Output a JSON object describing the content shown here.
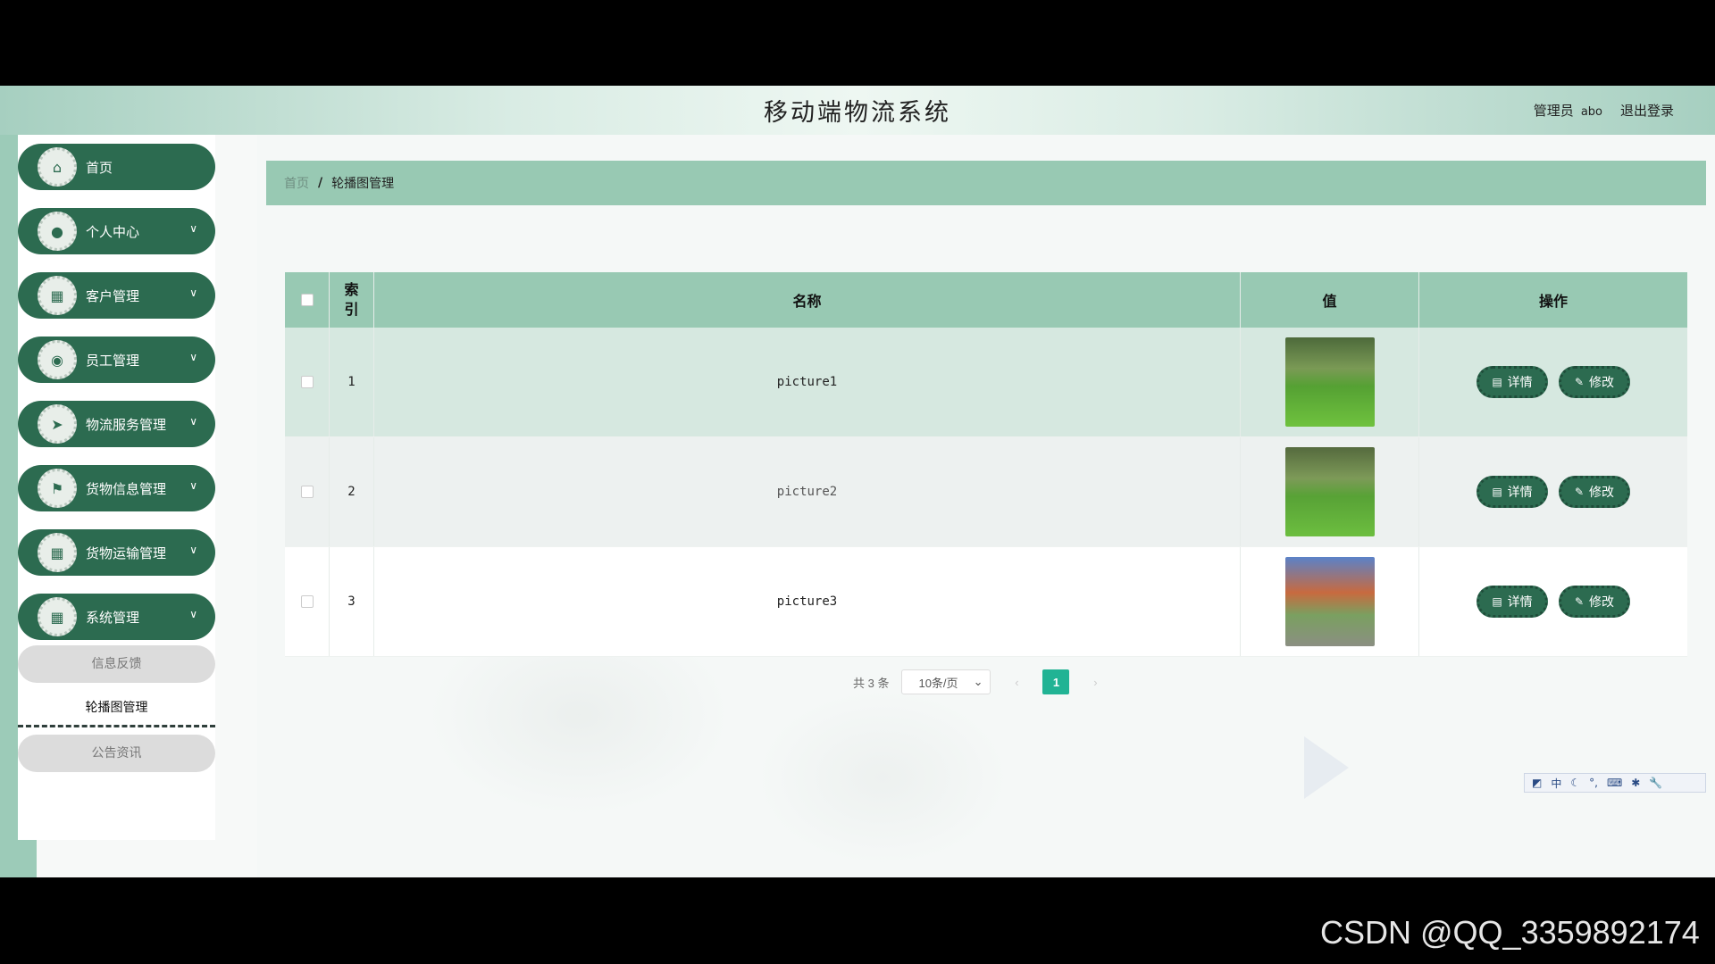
{
  "header": {
    "app_title": "移动端物流系统",
    "user_role": "管理员",
    "user_name": "abo",
    "logout_label": "退出登录"
  },
  "sidebar": {
    "items": [
      {
        "label": "首页",
        "icon": "home-icon",
        "has_arrow": false
      },
      {
        "label": "个人中心",
        "icon": "user-icon",
        "has_arrow": true
      },
      {
        "label": "客户管理",
        "icon": "grid-icon",
        "has_arrow": true
      },
      {
        "label": "员工管理",
        "icon": "location-icon",
        "has_arrow": true
      },
      {
        "label": "物流服务管理",
        "icon": "send-icon",
        "has_arrow": true
      },
      {
        "label": "货物信息管理",
        "icon": "flag-icon",
        "has_arrow": true
      },
      {
        "label": "货物运输管理",
        "icon": "grid-icon",
        "has_arrow": true
      },
      {
        "label": "系统管理",
        "icon": "grid-icon",
        "has_arrow": true
      }
    ],
    "sub_items": [
      {
        "label": "信息反馈"
      },
      {
        "label": "轮播图管理"
      },
      {
        "label": "公告资讯"
      }
    ]
  },
  "breadcrumb": {
    "home": "首页",
    "separator": "/",
    "current": "轮播图管理"
  },
  "table": {
    "headers": {
      "index_line1": "索",
      "index_line2": "引",
      "name": "名称",
      "value": "值",
      "operation": "操作"
    },
    "rows": [
      {
        "index": "1",
        "name": "picture1"
      },
      {
        "index": "2",
        "name": "picture2"
      },
      {
        "index": "3",
        "name": "picture3"
      }
    ],
    "detail_label": "详情",
    "edit_label": "修改"
  },
  "pagination": {
    "total_text": "共 3 条",
    "page_size": "10条/页",
    "current_page": "1"
  },
  "ime": {
    "lang": "中"
  },
  "watermark": "CSDN @QQ_3359892174",
  "colors": {
    "primary": "#2c6b50",
    "header_green": "#98c9b3",
    "page_active": "#21b394"
  }
}
